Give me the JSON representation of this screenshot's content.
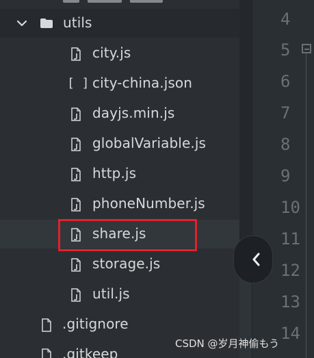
{
  "file_tree": {
    "folder": {
      "label": "utils",
      "expanded": true,
      "chevron_icon": "chevron-down-icon",
      "folder_icon": "folder-icon"
    },
    "files": [
      {
        "label": "city.js",
        "icon": "file-icon"
      },
      {
        "label": "city-china.json",
        "icon": "json-brackets-icon"
      },
      {
        "label": "dayjs.min.js",
        "icon": "file-icon"
      },
      {
        "label": "globalVariable.js",
        "icon": "file-icon"
      },
      {
        "label": "http.js",
        "icon": "file-icon"
      },
      {
        "label": "phoneNumber.js",
        "icon": "file-icon"
      },
      {
        "label": "share.js",
        "icon": "file-icon",
        "selected": true,
        "highlighted": true
      },
      {
        "label": "storage.js",
        "icon": "file-icon"
      },
      {
        "label": "util.js",
        "icon": "file-icon"
      }
    ],
    "root_files": [
      {
        "label": ".gitignore",
        "icon": "file-icon"
      },
      {
        "label": ".gitkeep",
        "icon": "file-icon"
      }
    ]
  },
  "editor": {
    "line_numbers": [
      "4",
      "5",
      "6",
      "7",
      "8",
      "9",
      "10",
      "11",
      "12",
      "13",
      "14"
    ],
    "fold_icon": "fold-minus-icon"
  },
  "collapse_handle": {
    "icon": "chevron-left-icon"
  },
  "watermark": {
    "text": "CSDN @岁月神偷もう"
  },
  "colors": {
    "sidebar_background": "#2b2f33",
    "text": "#d7dadc",
    "line_number": "#697177",
    "highlight_box": "#e1222a"
  }
}
